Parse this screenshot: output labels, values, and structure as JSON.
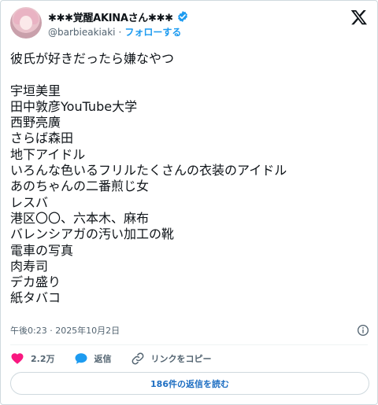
{
  "author": {
    "display_name": "✱✱✱覚醒AKINAさん✱✱✱",
    "handle": "@barbieakiaki",
    "separator": "·",
    "follow_label": "フォローする"
  },
  "icons": {
    "avatar": "avatar-image",
    "verified": "verified-badge-icon",
    "platform": "x-logo-icon",
    "info": "info-icon",
    "like": "heart-icon",
    "reply": "speech-bubble-icon",
    "copy_link": "link-icon"
  },
  "tweet": {
    "lines": [
      "彼氏が好きだったら嫌なやつ",
      "",
      "宇垣美里",
      "田中敦彦YouTube大学",
      "西野亮廣",
      "さらば森田",
      "地下アイドル",
      "いろんな色いるフリルたくさんの衣装のアイドル",
      "あのちゃんの二番煎じ女",
      "レスバ",
      "港区〇〇、六本木、麻布",
      "バレンシアガの汚い加工の靴",
      "電車の写真",
      "肉寿司",
      "デカ盛り",
      "紙タバコ"
    ],
    "timestamp": "午後0:23 · 2025年10月2日"
  },
  "actions": {
    "like_count": "2.2万",
    "reply_label": "返信",
    "copy_link_label": "リンクをコピー"
  },
  "replies_button": {
    "label": "186件の返信を読む"
  },
  "colors": {
    "accent": "#1d9bf0",
    "like": "#f91880",
    "muted": "#536471",
    "border": "#cfd9de"
  }
}
